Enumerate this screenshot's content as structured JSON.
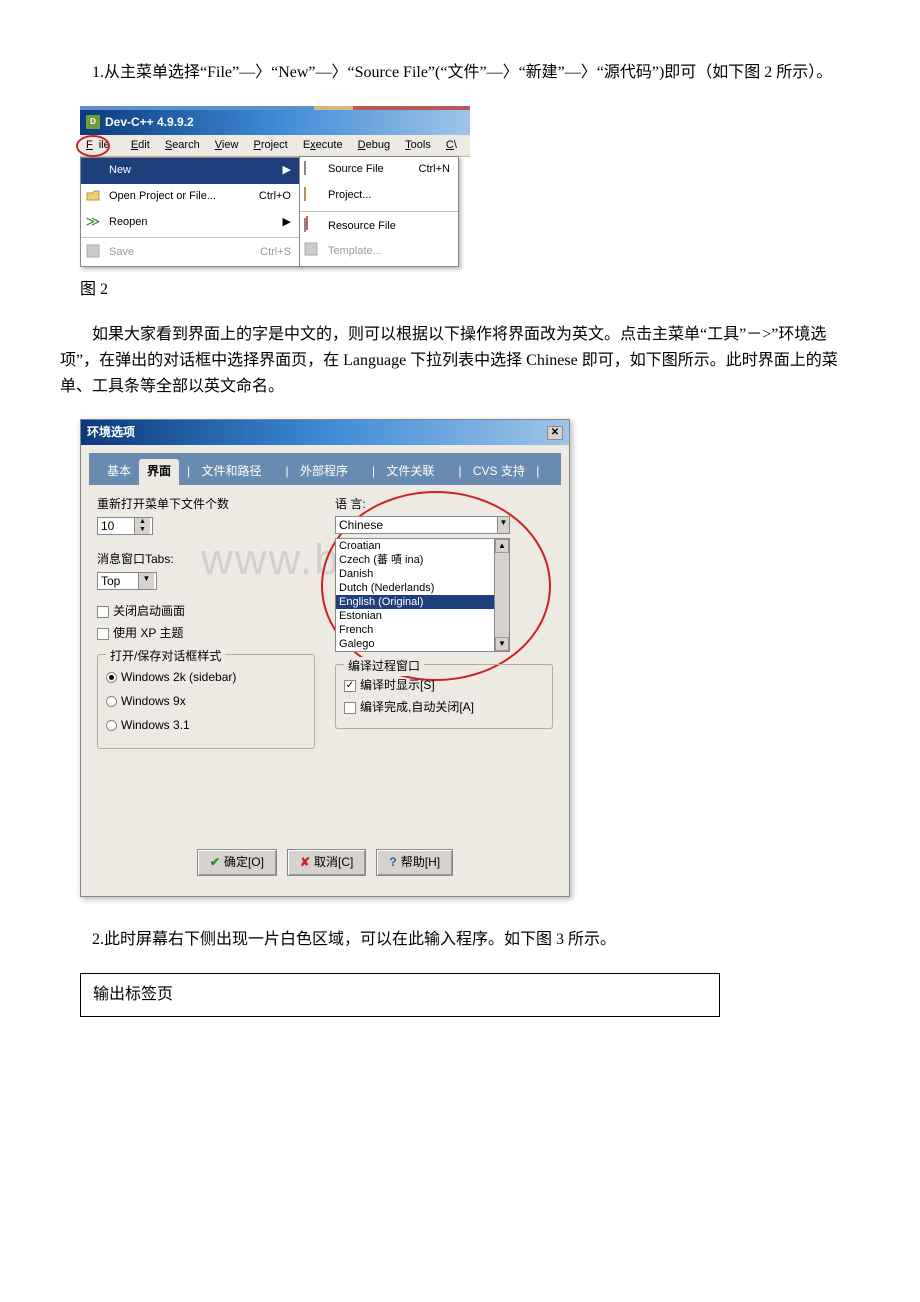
{
  "para1": "1.从主菜单选择“File”—〉“New”—〉“Source File”(“文件”—〉“新建”—〉“源代码”)即可（如下图 2 所示）。",
  "fig2_caption": "图 2",
  "para2": "如果大家看到界面上的字是中文的，则可以根据以下操作将界面改为英文。点击主菜单“工具”－>”环境选项”，在弹出的对话框中选择界面页，在 Language 下拉列表中选择 Chinese 即可，如下图所示。此时界面上的菜单、工具条等全部以英文命名。",
  "para3": "2.此时屏幕右下侧出现一片白色区域，可以在此输入程序。如下图 3 所示。",
  "bottom_table_text": "输出标签页",
  "devcpp": {
    "title": "Dev-C++ 4.9.9.2",
    "menubar": {
      "file": "File",
      "edit": "Edit",
      "search": "Search",
      "view": "View",
      "project": "Project",
      "execute": "Execute",
      "debug": "Debug",
      "tools": "Tools",
      "cvs": "C…"
    },
    "file_menu": {
      "new": "New",
      "open": "Open Project or File...",
      "open_shortcut": "Ctrl+O",
      "reopen": "Reopen",
      "save": "Save",
      "save_shortcut": "Ctrl+S"
    },
    "submenu": {
      "source": "Source File",
      "source_shortcut": "Ctrl+N",
      "project": "Project...",
      "resource": "Resource File",
      "template": "Template..."
    }
  },
  "env": {
    "title": "环境选项",
    "tabs": {
      "basic": "基本",
      "interface": "界面",
      "files": "文件和路径",
      "external": "外部程序",
      "assoc": "文件关联",
      "cvs": "CVS 支持"
    },
    "left": {
      "recent_label": "重新打开菜单下文件个数",
      "recent_value": "10",
      "tabs_label": "消息窗口Tabs:",
      "tabs_value": "Top",
      "disable_splash": "关闭启动画面",
      "xp_theme": "使用 XP 主题",
      "dlg_style_title": "打开/保存对话框样式",
      "r1": "Windows 2k (sidebar)",
      "r2": "Windows 9x",
      "r3": "Windows 3.1"
    },
    "right": {
      "lang_label": "语 言:",
      "lang_value": "Chinese",
      "opts": {
        "o1": "Croatian",
        "o2": "Czech (蕃 嘖 ina)",
        "o3": "Danish",
        "o4": "Dutch (Nederlands)",
        "o5": "English (Original)",
        "o6": "Estonian",
        "o7": "French",
        "o8": "Galego"
      },
      "compile_title": "编译过程窗口",
      "show_label": "编译时显示[S]",
      "autoclose_label": "编译完成,自动关闭[A]"
    },
    "buttons": {
      "ok": "确定[O]",
      "cancel": "取消[C]",
      "help": "帮助[H]"
    }
  },
  "watermark": "www.b    c .m"
}
